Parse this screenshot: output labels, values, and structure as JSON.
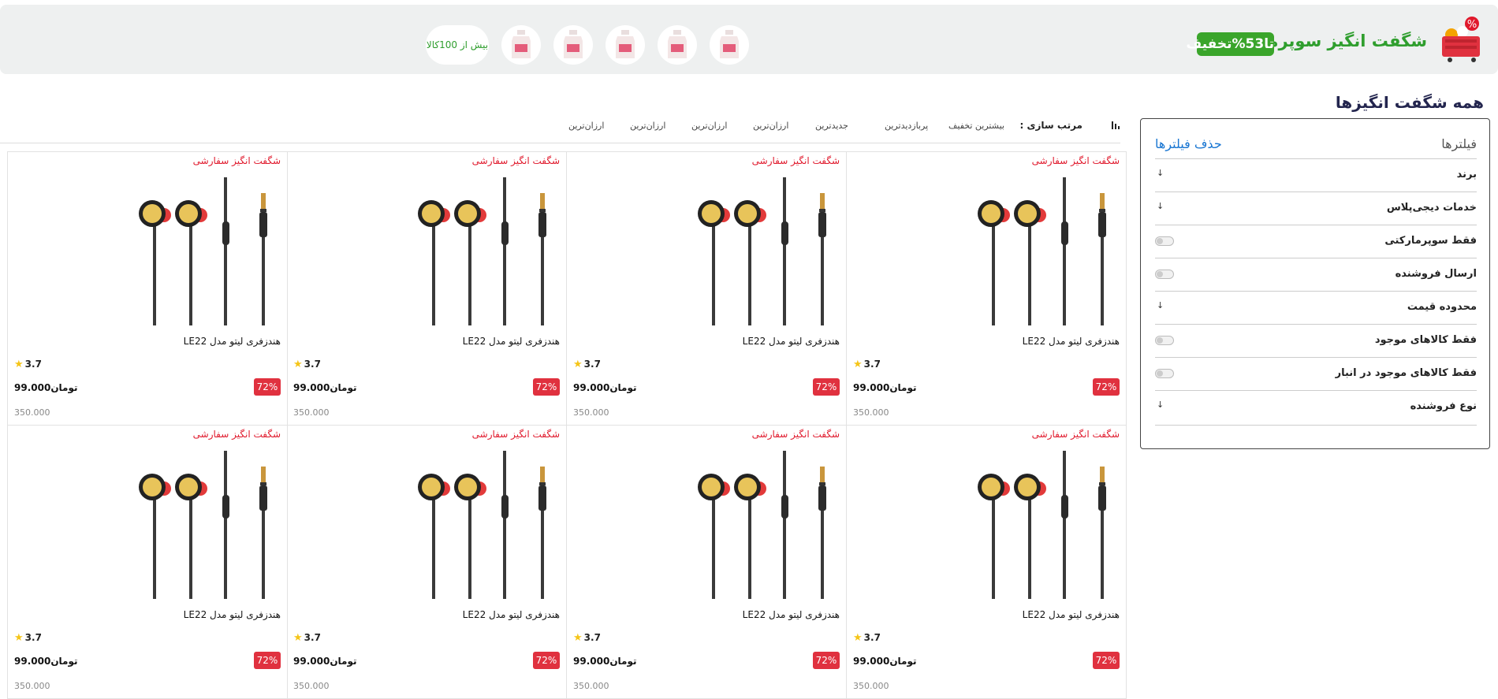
{
  "banner": {
    "title": "شگفت انگیز سوپرمارکتی",
    "badge": "تا53%تخفیف",
    "more_label": "بیش از 100کالا",
    "colors": {
      "green": "#2f9e2e",
      "badge_bg": "#3aa52b"
    },
    "thumbnail_icon": "detergent-bottle-icon",
    "thumbnail_count": 5
  },
  "page": {
    "title": "همه شگفت انگیزها"
  },
  "filters": {
    "title": "فیلترها",
    "clear_label": "حذف فیلترها",
    "items": [
      {
        "label": "برند",
        "control": "arrow"
      },
      {
        "label": "خدمات دیجی‌پلاس",
        "control": "arrow"
      },
      {
        "label": "فقط سوپرمارکتی",
        "control": "toggle"
      },
      {
        "label": "ارسال فروشنده",
        "control": "toggle"
      },
      {
        "label": "محدوده قیمت",
        "control": "arrow"
      },
      {
        "label": "فقط کالاهای موجود",
        "control": "toggle"
      },
      {
        "label": "فقط کالاهای موجود در انبار",
        "control": "toggle"
      },
      {
        "label": "نوع فروشنده",
        "control": "arrow"
      }
    ]
  },
  "sort": {
    "label": "مرتب سازی :",
    "options": [
      "بیشترین تخفیف",
      "پربازدیدترین",
      "جدیدترین",
      "ارزان‌ترین",
      "ارزان‌ترین",
      "ارزان‌ترین",
      "ارزان‌ترین"
    ]
  },
  "products": [
    {
      "tag": "شگفت انگیز سفارشی",
      "name": "هندزفری لیتو مدل LE22",
      "rating": "3.7",
      "discount": "72%",
      "price": "99.000تومان",
      "old_price": "350.000"
    },
    {
      "tag": "شگفت انگیز سفارشی",
      "name": "هندزفری لیتو مدل LE22",
      "rating": "3.7",
      "discount": "72%",
      "price": "99.000تومان",
      "old_price": "350.000"
    },
    {
      "tag": "شگفت انگیز سفارشی",
      "name": "هندزفری لیتو مدل LE22",
      "rating": "3.7",
      "discount": "72%",
      "price": "99.000تومان",
      "old_price": "350.000"
    },
    {
      "tag": "شگفت انگیز سفارشی",
      "name": "هندزفری لیتو مدل LE22",
      "rating": "3.7",
      "discount": "72%",
      "price": "99.000تومان",
      "old_price": "350.000"
    },
    {
      "tag": "شگفت انگیز سفارشی",
      "name": "هندزفری لیتو مدل LE22",
      "rating": "3.7",
      "discount": "72%",
      "price": "99.000تومان",
      "old_price": "350.000"
    },
    {
      "tag": "شگفت انگیز سفارشی",
      "name": "هندزفری لیتو مدل LE22",
      "rating": "3.7",
      "discount": "72%",
      "price": "99.000تومان",
      "old_price": "350.000"
    },
    {
      "tag": "شگفت انگیز سفارشی",
      "name": "هندزفری لیتو مدل LE22",
      "rating": "3.7",
      "discount": "72%",
      "price": "99.000تومان",
      "old_price": "350.000"
    },
    {
      "tag": "شگفت انگیز سفارشی",
      "name": "هندزفری لیتو مدل LE22",
      "rating": "3.7",
      "discount": "72%",
      "price": "99.000تومان",
      "old_price": "350.000"
    }
  ]
}
